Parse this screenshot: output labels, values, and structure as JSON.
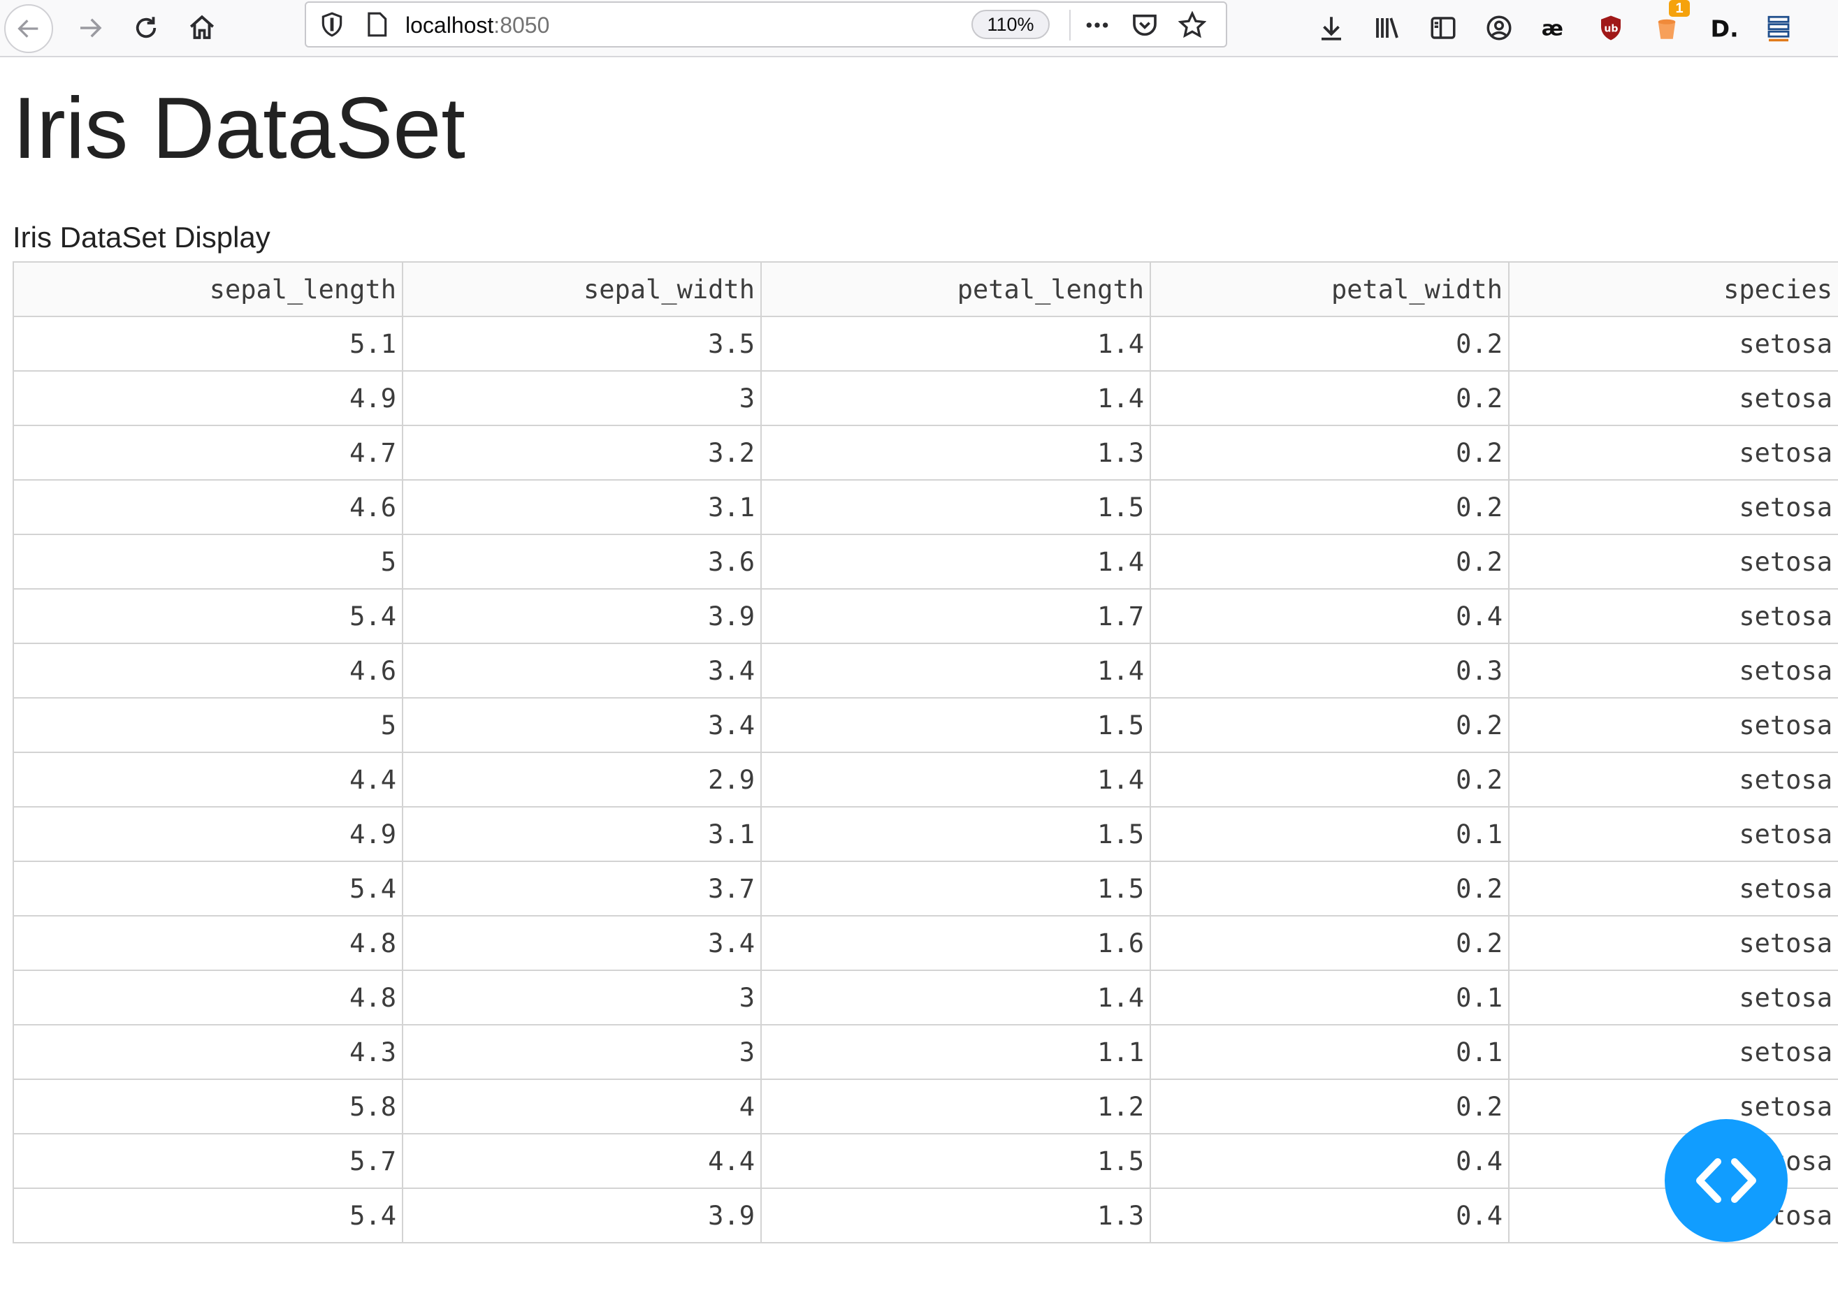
{
  "browser": {
    "url_host": "localhost",
    "url_port": ":8050",
    "zoom": "110%",
    "notification_count": "1",
    "colors": {
      "toolbar_bg": "#f9f9fa",
      "badge": "#f5a20c"
    },
    "icons": [
      "back-arrow-icon",
      "forward-arrow-icon",
      "reload-icon",
      "home-icon",
      "shield-icon",
      "page-icon",
      "more-icon",
      "pocket-icon",
      "star-icon",
      "download-icon",
      "library-icon",
      "sidebar-icon",
      "account-icon",
      "ae-icon",
      "ublock-icon",
      "bucket-icon",
      "d-icon",
      "menu-stack-icon"
    ]
  },
  "page": {
    "title": "Iris DataSet",
    "caption": "Iris DataSet Display"
  },
  "table": {
    "columns": [
      "sepal_length",
      "sepal_width",
      "petal_length",
      "petal_width",
      "species"
    ],
    "rows": [
      [
        "5.1",
        "3.5",
        "1.4",
        "0.2",
        "setosa"
      ],
      [
        "4.9",
        "3",
        "1.4",
        "0.2",
        "setosa"
      ],
      [
        "4.7",
        "3.2",
        "1.3",
        "0.2",
        "setosa"
      ],
      [
        "4.6",
        "3.1",
        "1.5",
        "0.2",
        "setosa"
      ],
      [
        "5",
        "3.6",
        "1.4",
        "0.2",
        "setosa"
      ],
      [
        "5.4",
        "3.9",
        "1.7",
        "0.4",
        "setosa"
      ],
      [
        "4.6",
        "3.4",
        "1.4",
        "0.3",
        "setosa"
      ],
      [
        "5",
        "3.4",
        "1.5",
        "0.2",
        "setosa"
      ],
      [
        "4.4",
        "2.9",
        "1.4",
        "0.2",
        "setosa"
      ],
      [
        "4.9",
        "3.1",
        "1.5",
        "0.1",
        "setosa"
      ],
      [
        "5.4",
        "3.7",
        "1.5",
        "0.2",
        "setosa"
      ],
      [
        "4.8",
        "3.4",
        "1.6",
        "0.2",
        "setosa"
      ],
      [
        "4.8",
        "3",
        "1.4",
        "0.1",
        "setosa"
      ],
      [
        "4.3",
        "3",
        "1.1",
        "0.1",
        "setosa"
      ],
      [
        "5.8",
        "4",
        "1.2",
        "0.2",
        "setosa"
      ],
      [
        "5.7",
        "4.4",
        "1.5",
        "0.4",
        "setosa"
      ],
      [
        "5.4",
        "3.9",
        "1.3",
        "0.4",
        "setosa"
      ]
    ]
  },
  "debug_button": {
    "icon": "code-brackets-icon",
    "color": "#119dff"
  }
}
